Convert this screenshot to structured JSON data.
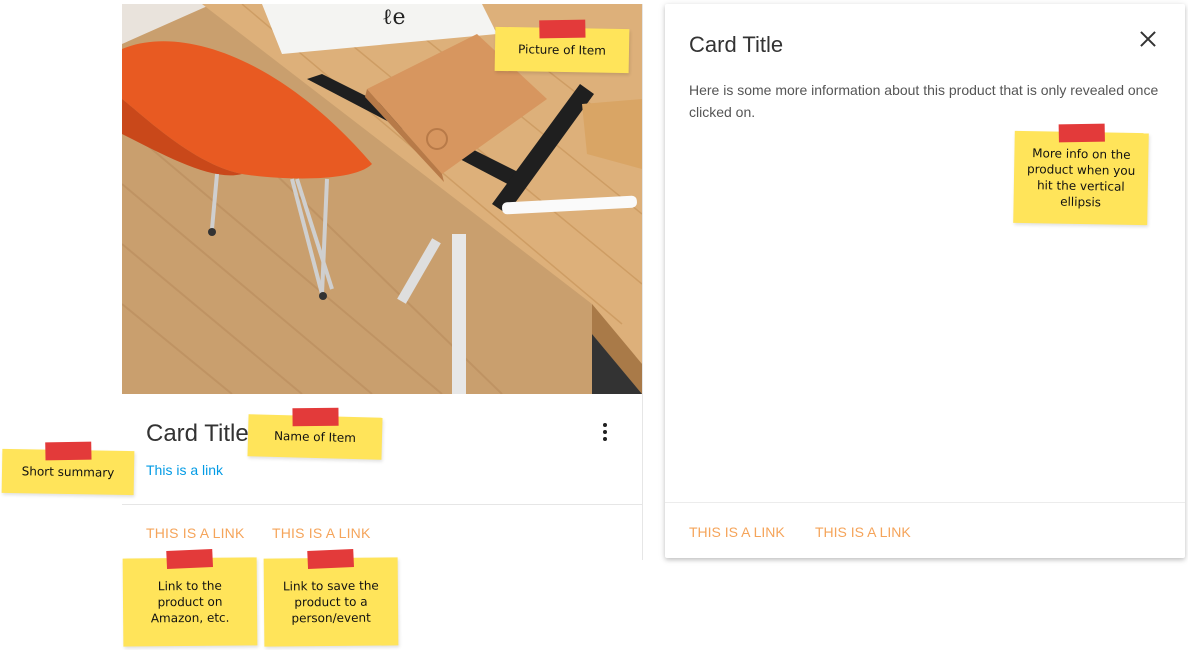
{
  "card": {
    "title": "Card Title",
    "summary_link": "This is a link",
    "action_1": "THIS IS A LINK",
    "action_2": "THIS IS A LINK"
  },
  "reveal": {
    "title": "Card Title",
    "body": "Here is some more information about this product that is only revealed once clicked on.",
    "action_1": "THIS IS A LINK",
    "action_2": "THIS IS A LINK"
  },
  "annotations": {
    "picture": "Picture of Item",
    "name": "Name of Item",
    "summary": "Short summary",
    "link_amazon": "Link to the\nproduct on\nAmazon, etc.",
    "link_save": "Link to save the\nproduct to a\nperson/event",
    "more_info": "More info on the\nproduct when you\nhit the vertical\nellipsis"
  },
  "icons": {
    "more": "more-vert-icon",
    "close": "close-icon"
  },
  "colors": {
    "link_blue": "#039be5",
    "action_orange": "#f5a45a",
    "note_yellow": "#ffe45a",
    "tape_red": "#e33a3a"
  }
}
